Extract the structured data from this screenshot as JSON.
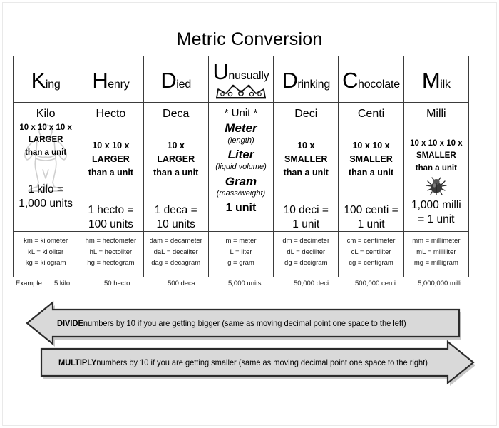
{
  "title": "Metric Conversion",
  "table": {
    "mnemonic": [
      {
        "cap": "K",
        "rest": "ing"
      },
      {
        "cap": "H",
        "rest": "enry"
      },
      {
        "cap": "D",
        "rest": "ied"
      },
      {
        "cap": "U",
        "rest": "nusually"
      },
      {
        "cap": "D",
        "rest": "rinking"
      },
      {
        "cap": "C",
        "rest": "hocolate"
      },
      {
        "cap": "M",
        "rest": "ilk"
      }
    ],
    "prefix": [
      "Kilo",
      "Hecto",
      "Deca",
      "* Unit *",
      "Deci",
      "Centi",
      "Milli"
    ],
    "magnitude": [
      {
        "factor": "10 x 10 x 10 x",
        "direction": "LARGER",
        "than": "than a unit"
      },
      {
        "factor": "10 x 10 x",
        "direction": "LARGER",
        "than": "than a unit"
      },
      {
        "factor": "10 x",
        "direction": "LARGER",
        "than": "than a unit"
      },
      null,
      {
        "factor": "10 x",
        "direction": "SMALLER",
        "than": "than a unit"
      },
      {
        "factor": "10 x 10 x",
        "direction": "SMALLER",
        "than": "than a unit"
      },
      {
        "factor": "10 x 10 x 10 x",
        "direction": "SMALLER",
        "than": "than a unit"
      }
    ],
    "equation": [
      {
        "line1": "1 kilo =",
        "line2": "1,000 units"
      },
      {
        "line1": "1 hecto =",
        "line2": "100 units"
      },
      {
        "line1": "1 deca =",
        "line2": "10 units"
      },
      null,
      {
        "line1": "10 deci =",
        "line2": "1 unit"
      },
      {
        "line1": "100 centi =",
        "line2": "1 unit"
      },
      {
        "line1": "1,000 milli",
        "line2": "= 1 unit"
      }
    ],
    "unit_column": {
      "header": "* Unit *",
      "meter": "Meter",
      "meter_note": "(length)",
      "liter": "Liter",
      "liter_note": "(liquid volume)",
      "gram": "Gram",
      "gram_note": "(mass/weight)",
      "one_unit": "1 unit"
    },
    "abbreviations": [
      [
        "km = kilometer",
        "kL = kiloliter",
        "kg = kilogram"
      ],
      [
        "hm = hectometer",
        "hL = hectoliter",
        "hg = hectogram"
      ],
      [
        "dam = decameter",
        "daL = decaliter",
        "dag = decagram"
      ],
      [
        "m = meter",
        "L = liter",
        "g = gram"
      ],
      [
        "dm = decimeter",
        "dL = deciliter",
        "dg = decigram"
      ],
      [
        "cm = centimeter",
        "cL = centiliter",
        "cg = centigram"
      ],
      [
        "mm = millimeter",
        "mL = milliliter",
        "mg = milligram"
      ]
    ],
    "example": {
      "label": "Example:",
      "values": [
        "5 kilo",
        "50 hecto",
        "500 deca",
        "5,000 units",
        "50,000 deci",
        "500,000 centi",
        "5,000,000 milli"
      ]
    }
  },
  "arrows": {
    "divide": {
      "strong": "DIVIDE",
      "text": " numbers by 10 if you are getting bigger (same as moving decimal point one space to the left)"
    },
    "multiply": {
      "strong": "MULTIPLY",
      "text": " numbers by 10 if you are getting smaller (same as moving decimal point one space to the right)"
    }
  },
  "colors": {
    "arrow_fill": "#d9d9d9",
    "arrow_stroke": "#2b2b2b",
    "border": "#3b3b3b"
  }
}
